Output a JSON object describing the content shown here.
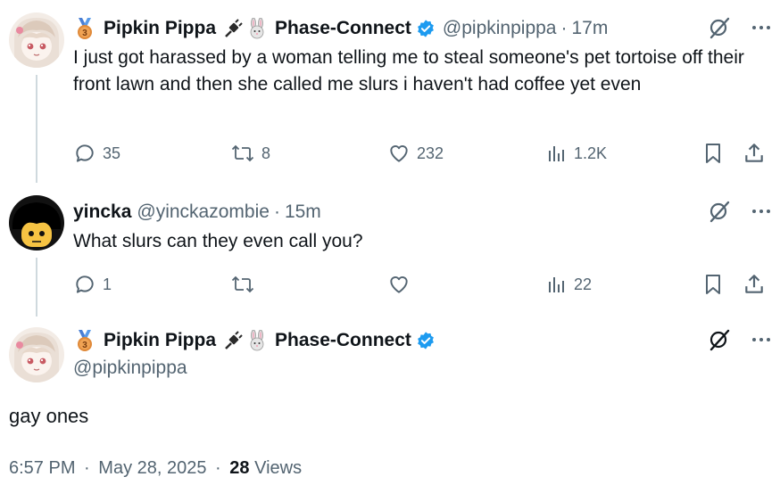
{
  "reply1": {
    "name": "Pipkin Pippa",
    "affiliation": "Phase-Connect",
    "handle": "@pipkinpippa",
    "time": "17m",
    "text": "I just got harassed by a woman telling me to steal someone's pet tortoise off their front lawn and then she called me slurs i haven't had coffee yet even",
    "stats": {
      "replies": "35",
      "reposts": "8",
      "likes": "232",
      "views": "1.2K"
    }
  },
  "reply2": {
    "name": "yincka",
    "handle": "@yinckazombie",
    "time": "15m",
    "text": "What slurs can they even call you?",
    "stats": {
      "replies": "1",
      "reposts": "",
      "likes": "",
      "views": "22"
    }
  },
  "main": {
    "name": "Pipkin Pippa",
    "affiliation": "Phase-Connect",
    "handle": "@pipkinpippa",
    "text": "gay ones",
    "time": "6:57 PM",
    "date": "May 28, 2025",
    "views_count": "28",
    "views_label": "Views"
  },
  "separator": "·",
  "icons": [
    "medal-icon",
    "plug-icon",
    "rabbit-icon",
    "verified-badge-icon",
    "grok-icon",
    "more-icon",
    "reply-icon",
    "repost-icon",
    "like-icon",
    "views-icon",
    "bookmark-icon",
    "share-icon"
  ],
  "colors": {
    "text": "#0f1419",
    "secondary": "#536471",
    "verified": "#1d9bf0",
    "thread_line": "#cfd9de"
  }
}
